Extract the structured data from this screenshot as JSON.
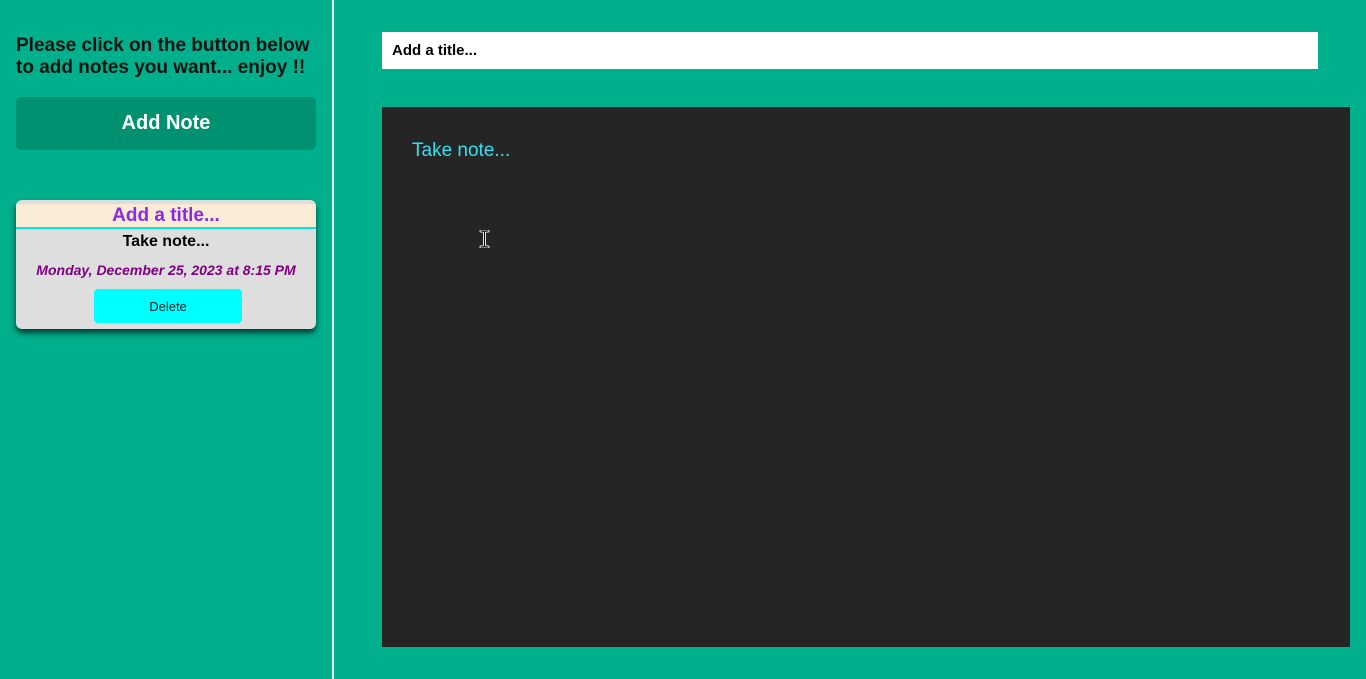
{
  "sidebar": {
    "intro_text": "Please click on the button below to add notes you want... enjoy !!",
    "add_button_label": "Add Note",
    "notes": [
      {
        "title": "Add a title...",
        "body": "Take note...",
        "date": "Monday, December 25, 2023 at 8:15 PM",
        "delete_label": "Delete"
      }
    ]
  },
  "editor": {
    "title_placeholder": "Add a title...",
    "body_placeholder": "Take note..."
  },
  "colors": {
    "background": "#00af8b",
    "add_button": "#009171",
    "editor_background": "#252525",
    "editor_text": "#33e0f0",
    "note_title_text": "#8a2be2",
    "note_title_bg": "#faebd7",
    "note_date": "#800080",
    "delete_button": "#00ffff"
  },
  "icons": {
    "cursor": "text-cursor-icon"
  }
}
